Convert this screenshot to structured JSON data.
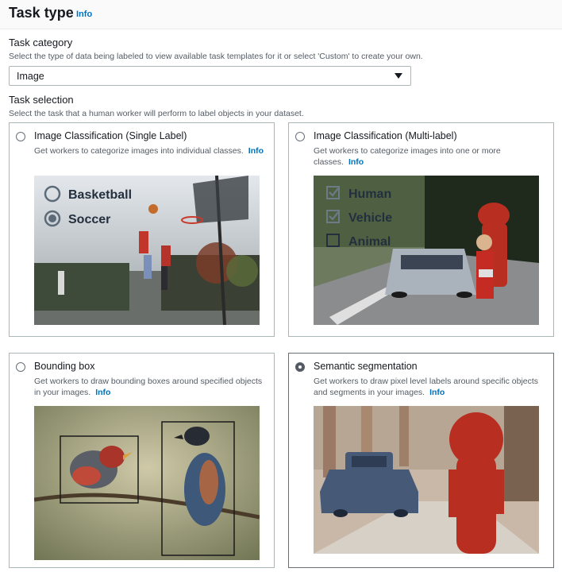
{
  "header": {
    "title": "Task type",
    "info": "Info"
  },
  "task_category": {
    "label": "Task category",
    "description": "Select the type of data being labeled to view available task templates for it or select 'Custom' to create your own.",
    "selected_value": "Image"
  },
  "task_selection": {
    "label": "Task selection",
    "description": "Select the task that a human worker will perform to label objects in your dataset."
  },
  "cards": [
    {
      "title": "Image Classification (Single Label)",
      "description": "Get workers to categorize images into individual classes.",
      "info": "Info",
      "selected": false,
      "overlay": [
        "Basketball",
        "Soccer"
      ]
    },
    {
      "title": "Image Classification (Multi-label)",
      "description": "Get workers to categorize images into one or more classes.",
      "info": "Info",
      "selected": false,
      "overlay": [
        "Human",
        "Vehicle",
        "Animal"
      ]
    },
    {
      "title": "Bounding box",
      "description": "Get workers to draw bounding boxes around specified objects in your images.",
      "info": "Info",
      "selected": false
    },
    {
      "title": "Semantic segmentation",
      "description": "Get workers to draw pixel level labels around specific objects and segments in your images.",
      "info": "Info",
      "selected": true
    }
  ],
  "colors": {
    "link": "#0073bb",
    "segmentation_red": "#b82f22"
  }
}
